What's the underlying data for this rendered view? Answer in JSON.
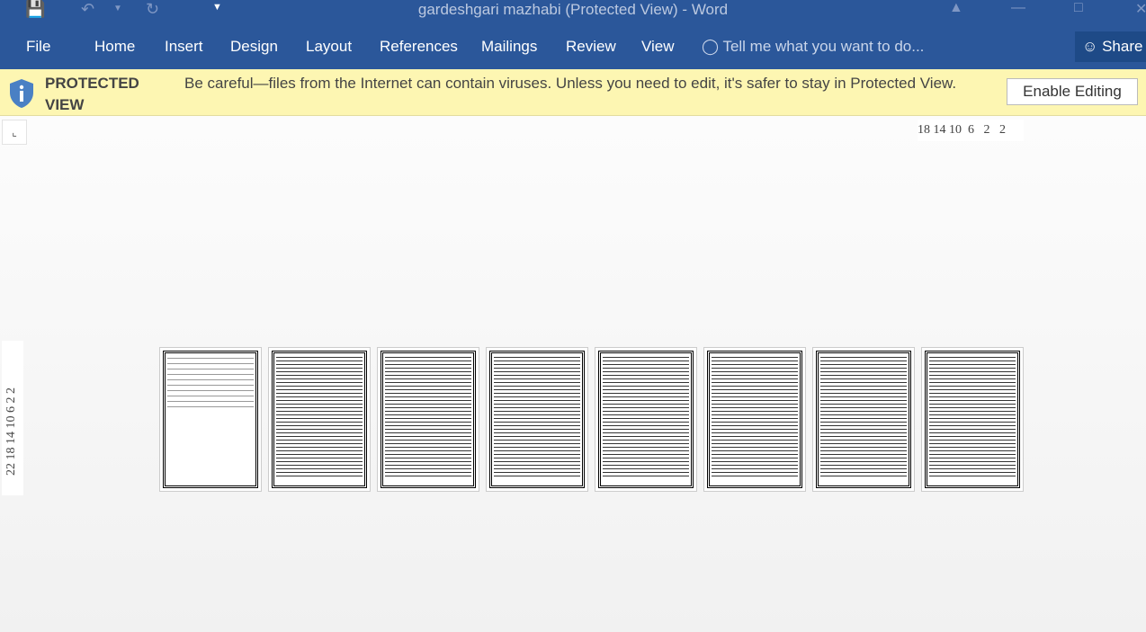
{
  "window": {
    "title": "gardeshgari mazhabi (Protected View) - Word"
  },
  "quick_access": {
    "icons": [
      "save-icon",
      "undo-icon",
      "redo-icon",
      "customize-icon"
    ]
  },
  "ribbon": {
    "tabs": [
      "File",
      "Home",
      "Insert",
      "Design",
      "Layout",
      "References",
      "Mailings",
      "Review",
      "View"
    ],
    "tell_me": "Tell me what you want to do...",
    "share": "Share"
  },
  "protected_view": {
    "title": "PROTECTED VIEW",
    "message": "Be careful—files from the Internet can contain viruses. Unless you need to edit, it's safer to stay in Protected View.",
    "button": "Enable Editing"
  },
  "rulers": {
    "horizontal": "18 14 10  6   2   2",
    "vertical": "22 18 14 10  6  2   2"
  },
  "pages": {
    "count": 8
  }
}
